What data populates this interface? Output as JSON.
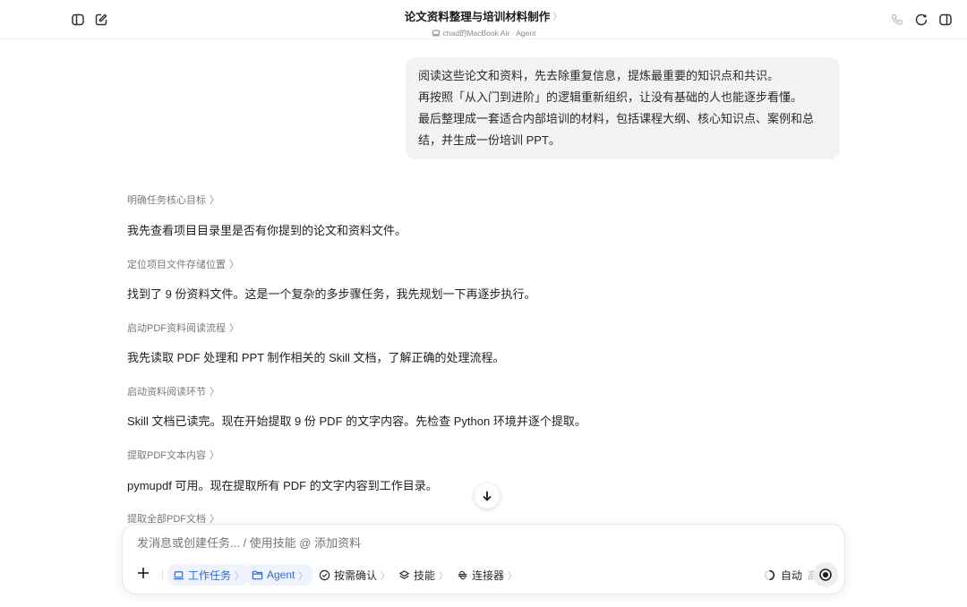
{
  "header": {
    "title": "论文资料整理与培训材料制作",
    "title_chevron": "〉",
    "subtitle": "chad的MacBook Air · Agent"
  },
  "user_message": {
    "lines": [
      "阅读这些论文和资料，先去除重复信息，提炼最重要的知识点和共识。",
      "再按照「从入门到进阶」的逻辑重新组织，让没有基础的人也能逐步看懂。",
      "最后整理成一套适合内部培训的材料，包括课程大纲、核心知识点、案例和总",
      "结，并生成一份培训 PPT。"
    ]
  },
  "steps": [
    {
      "title": "明确任务核心目标",
      "text": "我先查看项目目录里是否有你提到的论文和资料文件。"
    },
    {
      "title": "定位项目文件存储位置",
      "text": "找到了 9 份资料文件。这是一个复杂的多步骤任务，我先规划一下再逐步执行。"
    },
    {
      "title": "启动PDF资料阅读流程",
      "text": "我先读取 PDF 处理和 PPT 制作相关的 Skill 文档，了解正确的处理流程。"
    },
    {
      "title": "启动资料阅读环节",
      "text": "Skill 文档已读完。现在开始提取 9 份 PDF 的文字内容。先检查 Python 环境并逐个提取。"
    },
    {
      "title": "提取PDF文本内容",
      "text": "pymupdf 可用。现在提取所有 PDF 的文字内容到工作目录。"
    },
    {
      "title": "提取全部PDF文档",
      "text": ""
    }
  ],
  "step_arrow": "〉",
  "composer": {
    "placeholder": "发消息或创建任务... / 使用技能 @ 添加资料",
    "chips": {
      "work_task": "工作任务",
      "agent": "Agent",
      "confirm": "按需确认",
      "skills": "技能",
      "connectors": "连接器"
    },
    "chip_chevron": "〉",
    "auto_label": "自动",
    "auto_level": "高"
  },
  "colors": {
    "accent": "#2f6bd6",
    "bubble_bg": "#f3f3f3"
  }
}
